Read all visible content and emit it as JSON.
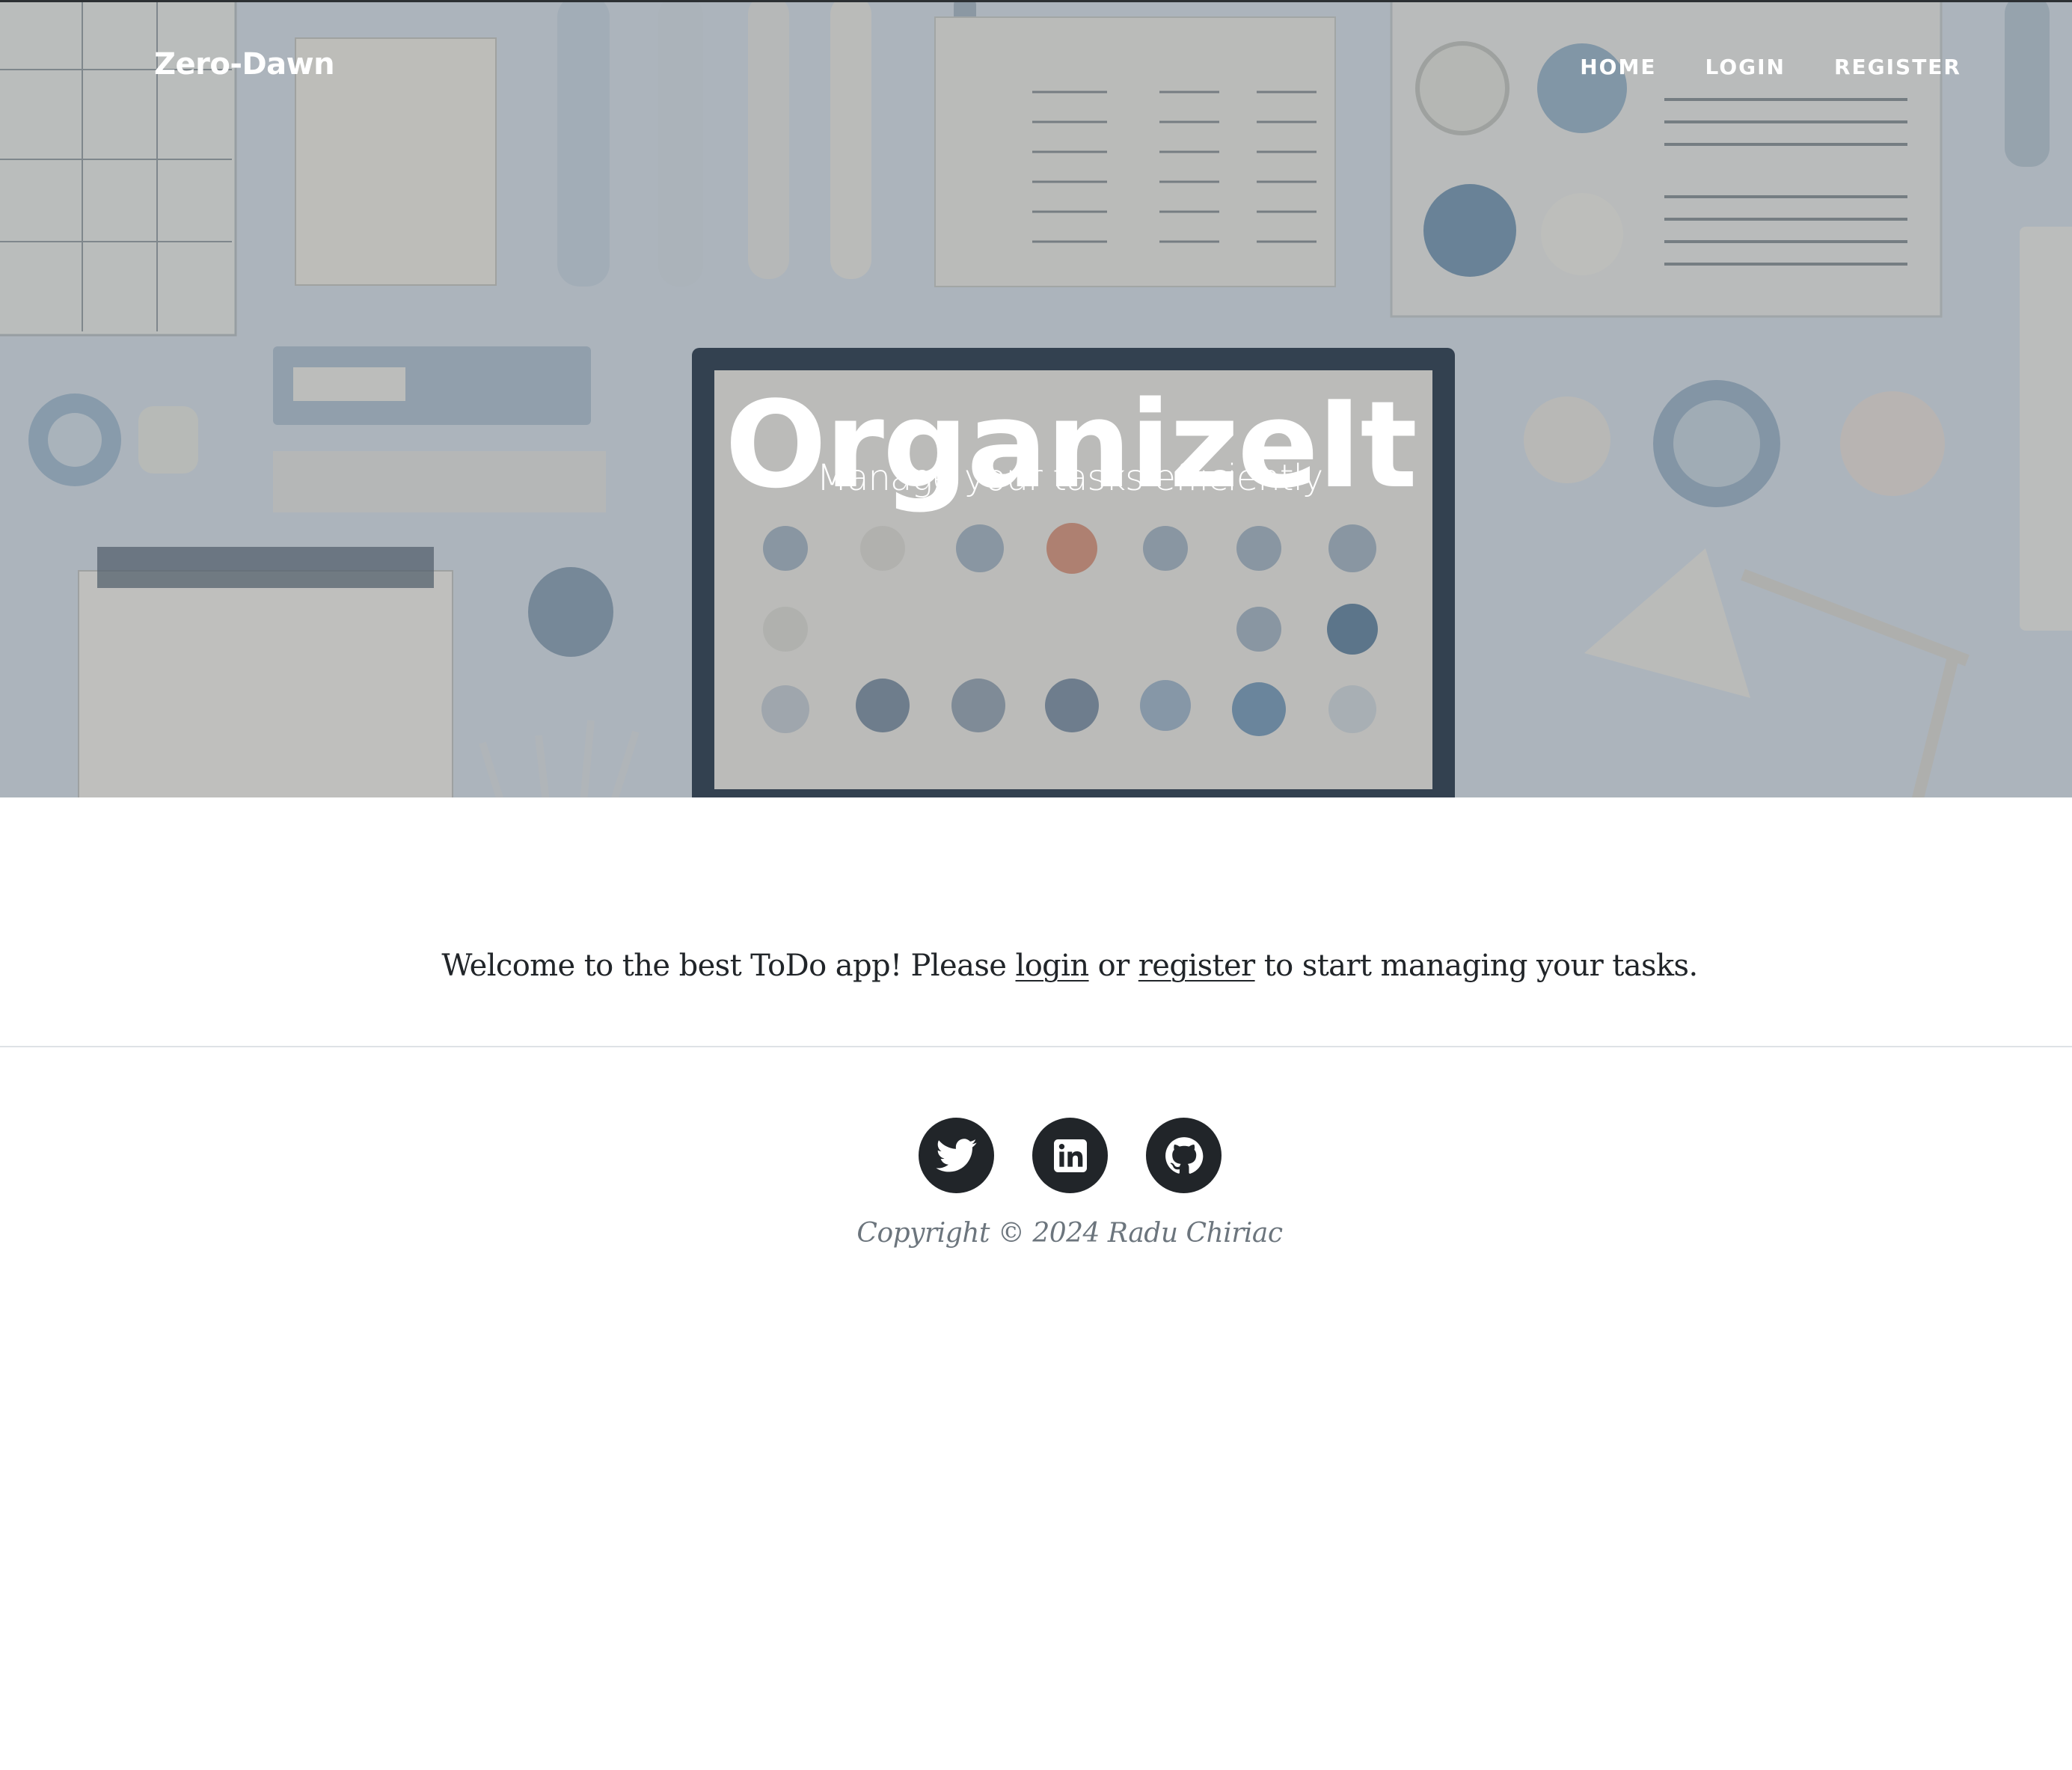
{
  "navbar": {
    "brand": "Zero-Dawn",
    "links": [
      "HOME",
      "LOGIN",
      "REGISTER"
    ]
  },
  "hero": {
    "heading": "OrganizeIt",
    "subheading": "Manage your tasks efficiently"
  },
  "main": {
    "welcome_before": "Welcome to the best ToDo app! Please ",
    "login_link": "login",
    "welcome_middle": " or ",
    "register_link": "register",
    "welcome_after": " to start managing your tasks."
  },
  "footer": {
    "social_icons": [
      "twitter-icon",
      "linkedin-icon",
      "github-icon"
    ],
    "copyright": "Copyright © 2024 Radu Chiriac"
  },
  "colors": {
    "hero_bg": "#cfd9e2",
    "dark": "#212529",
    "muted": "#6c757d",
    "divider": "#dee2e6"
  }
}
